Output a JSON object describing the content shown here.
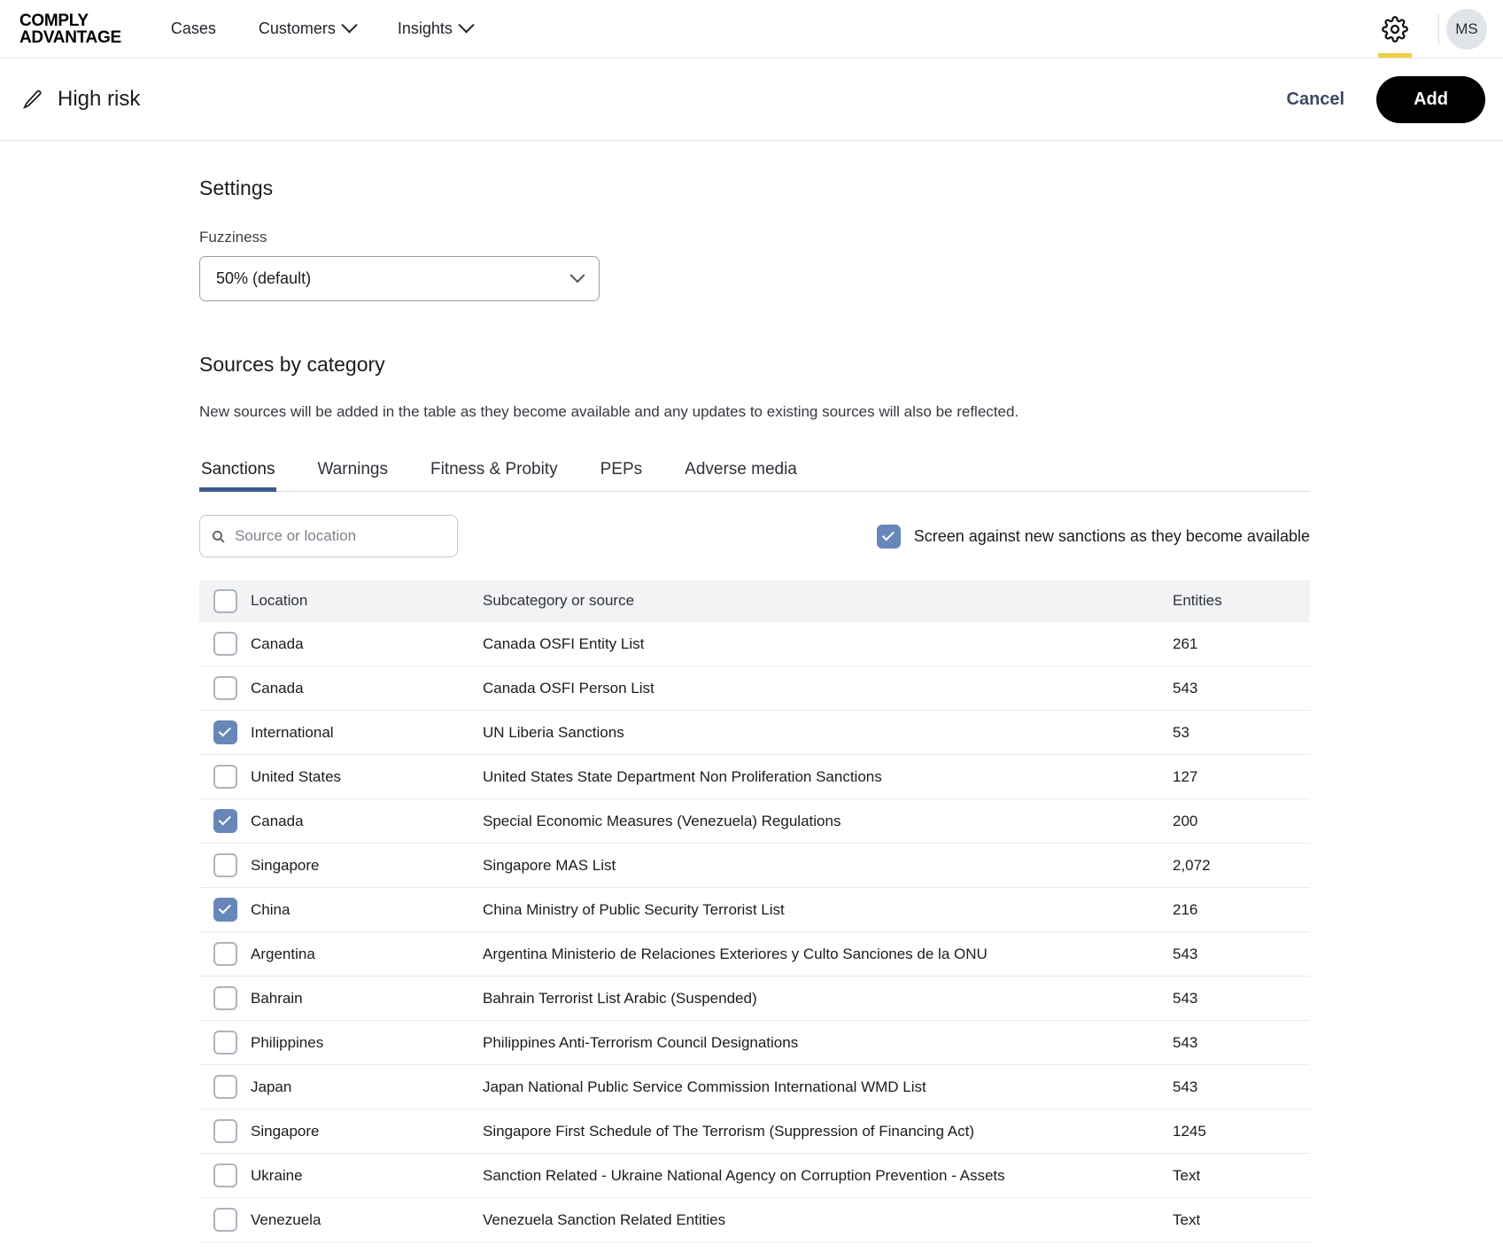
{
  "topbar": {
    "brand": "COMPLY\nADVANTAGE",
    "nav": [
      {
        "label": "Cases",
        "has_caret": false
      },
      {
        "label": "Customers",
        "has_caret": true
      },
      {
        "label": "Insights",
        "has_caret": true
      }
    ],
    "settings_icon": "gear-icon",
    "active_indicator_color": "#f0ce42",
    "avatar_initials": "MS"
  },
  "subheader": {
    "edit_icon": "pencil-icon",
    "title": "High risk",
    "cancel_label": "Cancel",
    "add_label": "Add"
  },
  "settings": {
    "title": "Settings",
    "fuzziness_label": "Fuzziness",
    "fuzziness_value": "50% (default)"
  },
  "sources": {
    "title": "Sources by category",
    "description": "New sources will be added in the table as they become available and any updates to existing sources will also be reflected.",
    "tabs": [
      {
        "label": "Sanctions",
        "active": true
      },
      {
        "label": "Warnings",
        "active": false
      },
      {
        "label": "Fitness & Probity",
        "active": false
      },
      {
        "label": "PEPs",
        "active": false
      },
      {
        "label": "Adverse media",
        "active": false
      }
    ],
    "search_placeholder": "Source or location",
    "search_value": "",
    "screen_toggle_label": "Screen against new sanctions as they become available",
    "screen_toggle_checked": true,
    "accent_checkbox_color": "#6787b8",
    "tab_underline_color": "#3c5b8b"
  },
  "table": {
    "headers": {
      "location": "Location",
      "subcategory": "Subcategory or source",
      "entities": "Entities"
    },
    "select_all_checked": false,
    "rows": [
      {
        "checked": false,
        "location": "Canada",
        "source": "Canada OSFI Entity List",
        "entities": "261"
      },
      {
        "checked": false,
        "location": "Canada",
        "source": "Canada OSFI Person List",
        "entities": "543"
      },
      {
        "checked": true,
        "location": "International",
        "source": "UN Liberia Sanctions",
        "entities": "53"
      },
      {
        "checked": false,
        "location": "United States",
        "source": "United States State Department Non Proliferation Sanctions",
        "entities": "127"
      },
      {
        "checked": true,
        "location": "Canada",
        "source": "Special Economic Measures (Venezuela) Regulations",
        "entities": "200"
      },
      {
        "checked": false,
        "location": "Singapore",
        "source": "Singapore MAS List",
        "entities": "2,072"
      },
      {
        "checked": true,
        "location": "China",
        "source": "China Ministry of Public Security Terrorist List",
        "entities": "216"
      },
      {
        "checked": false,
        "location": "Argentina",
        "source": "Argentina Ministerio de Relaciones Exteriores y Culto Sanciones de la ONU",
        "entities": "543"
      },
      {
        "checked": false,
        "location": "Bahrain",
        "source": "Bahrain Terrorist List Arabic (Suspended)",
        "entities": "543"
      },
      {
        "checked": false,
        "location": "Philippines",
        "source": "Philippines Anti-Terrorism Council Designations",
        "entities": "543"
      },
      {
        "checked": false,
        "location": "Japan",
        "source": "Japan National Public Service Commission International WMD List",
        "entities": "543"
      },
      {
        "checked": false,
        "location": "Singapore",
        "source": "Singapore First Schedule of The Terrorism (Suppression of Financing Act)",
        "entities": "1245"
      },
      {
        "checked": false,
        "location": "Ukraine",
        "source": "Sanction Related - Ukraine National Agency on Corruption Prevention - Assets",
        "entities": "Text"
      },
      {
        "checked": false,
        "location": "Venezuela",
        "source": "Venezuela Sanction Related Entities",
        "entities": "Text"
      }
    ]
  }
}
